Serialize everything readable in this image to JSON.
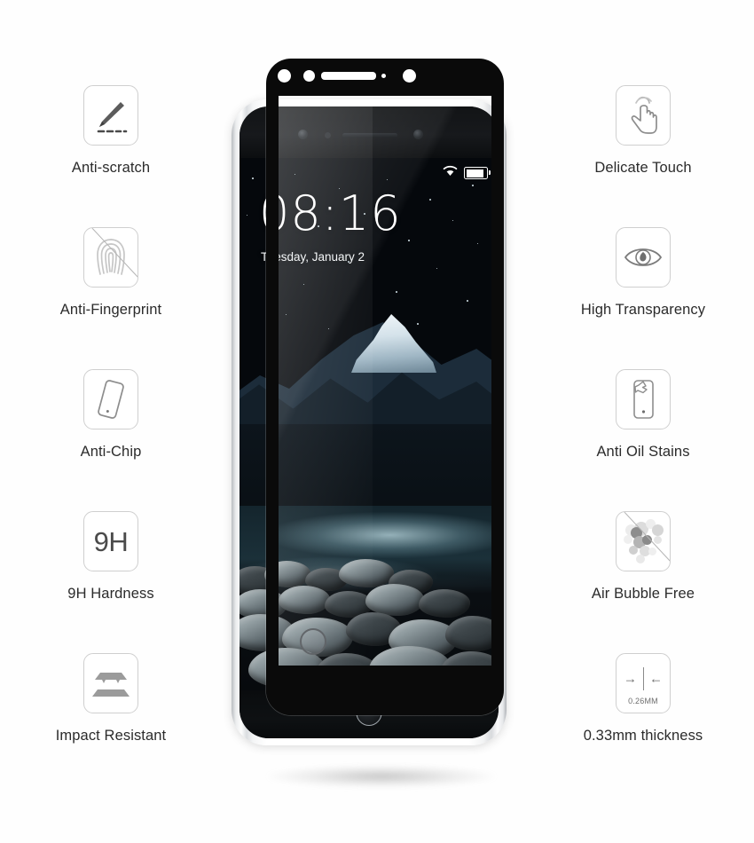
{
  "product": {
    "type": "tempered-glass-screen-protector-infographic",
    "background_color": "#ffffff",
    "icon_border_color": "#cfcfcf",
    "label_color": "#2b2b2b"
  },
  "features_left": [
    {
      "label": "Anti-scratch",
      "icon": "knife-scratch-icon"
    },
    {
      "label": "Anti-Fingerprint",
      "icon": "fingerprint-slashed-icon"
    },
    {
      "label": "Anti-Chip",
      "icon": "tilted-phone-icon"
    },
    {
      "label": "9H Hardness",
      "icon": "nine-h-text-icon",
      "icon_text": "9H"
    },
    {
      "label": "Impact Resistant",
      "icon": "stacked-plates-icon"
    }
  ],
  "features_right": [
    {
      "label": "Delicate Touch",
      "icon": "tapping-hand-icon"
    },
    {
      "label": "High Transparency",
      "icon": "eye-icon"
    },
    {
      "label": "Anti Oil Stains",
      "icon": "phone-stain-icon"
    },
    {
      "label": "Air Bubble Free",
      "icon": "bubbles-slashed-icon"
    },
    {
      "label": "0.33mm thickness",
      "icon": "thickness-caliper-icon",
      "icon_text": "0.26MM"
    }
  ],
  "phone": {
    "lockscreen": {
      "time": "08:16",
      "date": "Tuesday, January 2"
    },
    "statusbar": {
      "wifi": "wifi-icon",
      "battery": "battery-full-icon"
    },
    "wallpaper": "night-mountain-river-rocks",
    "home_button": "home-button"
  }
}
